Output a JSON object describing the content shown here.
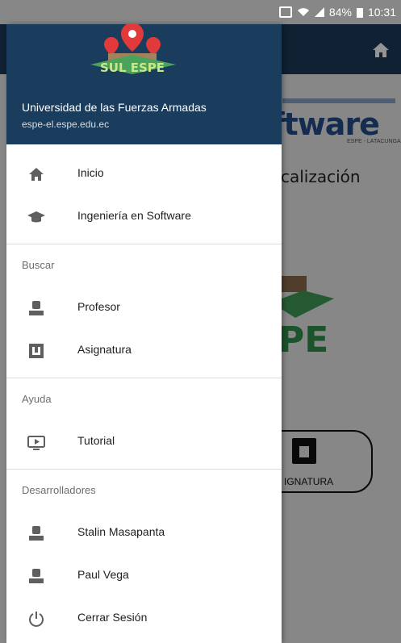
{
  "status_bar": {
    "battery": "84%",
    "time": "10:31"
  },
  "background": {
    "software_text": "ftware",
    "software_subtext": "ESPE - LATACUNGA",
    "localizacion_text": "calización",
    "logo_fragment_text": "PE",
    "button_label": "IGNATURA"
  },
  "drawer": {
    "header": {
      "logo_text": "SUL ESPE",
      "name": "Universidad de las Fuerzas Armadas",
      "email": "espe-el.espe.edu.ec"
    },
    "items_main": [
      {
        "label": "Inicio",
        "icon": "home-icon"
      },
      {
        "label": "Ingeniería en Software",
        "icon": "graduation-cap-icon"
      }
    ],
    "sections": [
      {
        "title": "Buscar",
        "items": [
          {
            "label": "Profesor",
            "icon": "person-icon"
          },
          {
            "label": "Asignatura",
            "icon": "book-icon"
          }
        ]
      },
      {
        "title": "Ayuda",
        "items": [
          {
            "label": "Tutorial",
            "icon": "play-video-icon"
          }
        ]
      },
      {
        "title": "Desarrolladores",
        "items": [
          {
            "label": "Stalin Masapanta",
            "icon": "person-icon"
          },
          {
            "label": "Paul Vega",
            "icon": "person-icon"
          },
          {
            "label": "Cerrar Sesión",
            "icon": "power-icon"
          }
        ]
      }
    ]
  }
}
